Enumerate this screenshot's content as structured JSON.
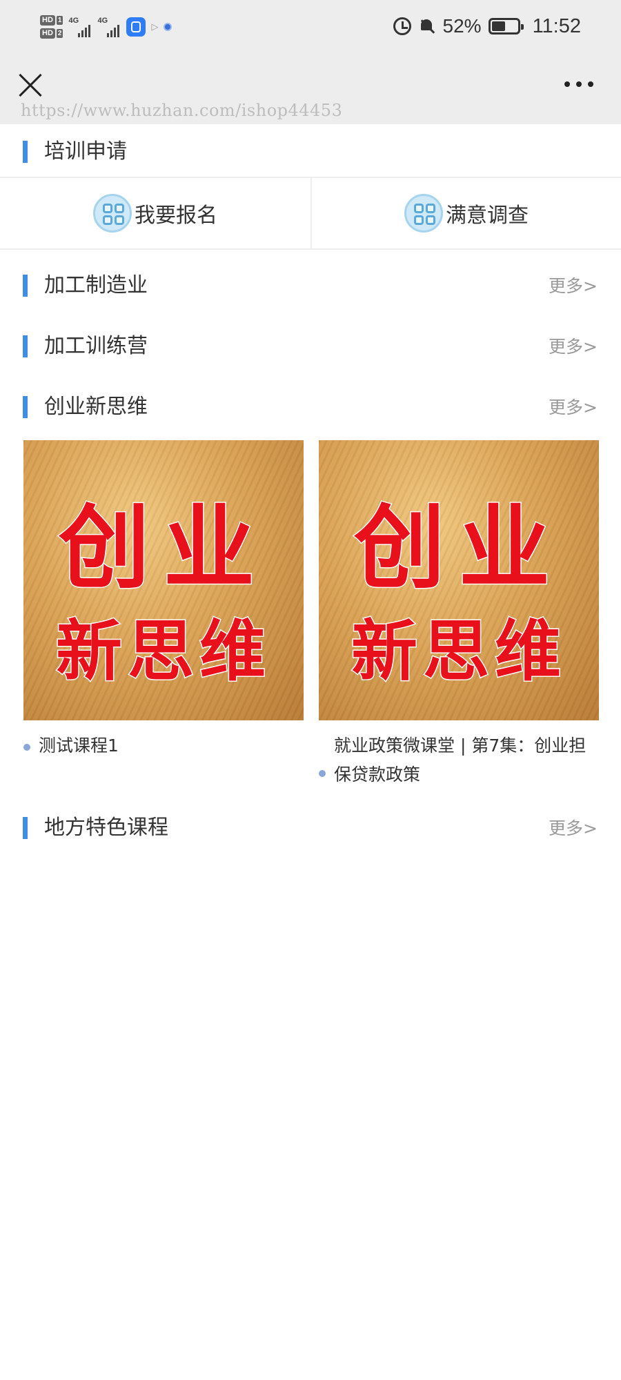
{
  "status_bar": {
    "sim1_badge": "HD",
    "sim1_num": "1",
    "sim2_badge": "HD",
    "sim2_num": "2",
    "net1": "4G",
    "net2": "4G",
    "battery_percent": "52%",
    "battery_level": 0.52,
    "time": "11:52",
    "icons": [
      "app-notification-icon",
      "play-icon",
      "shield-icon",
      "alarm-icon",
      "bell-muted-icon",
      "battery-icon"
    ]
  },
  "nav": {
    "close_icon": "close-icon",
    "more_icon": "more-dots-icon",
    "watermark": "https://www.huzhan.com/ishop44453"
  },
  "accent_color": "#3e8fe0",
  "sections": {
    "apply": {
      "title": "培训申请"
    },
    "manufacturing": {
      "title": "加工制造业",
      "more": "更多>"
    },
    "camp": {
      "title": "加工训练营",
      "more": "更多>"
    },
    "startup": {
      "title": "创业新思维",
      "more": "更多>"
    },
    "local": {
      "title": "地方特色课程",
      "more": "更多>"
    }
  },
  "apply_actions": [
    {
      "label": "我要报名",
      "icon": "grid-icon"
    },
    {
      "label": "满意调查",
      "icon": "grid-icon"
    }
  ],
  "courses": [
    {
      "thumb_line1": "创业",
      "thumb_line2": "新思维",
      "title": "测试课程1"
    },
    {
      "thumb_line1": "创业",
      "thumb_line2": "新思维",
      "title": "就业政策微课堂 | 第7集：创业担保贷款政策"
    }
  ]
}
